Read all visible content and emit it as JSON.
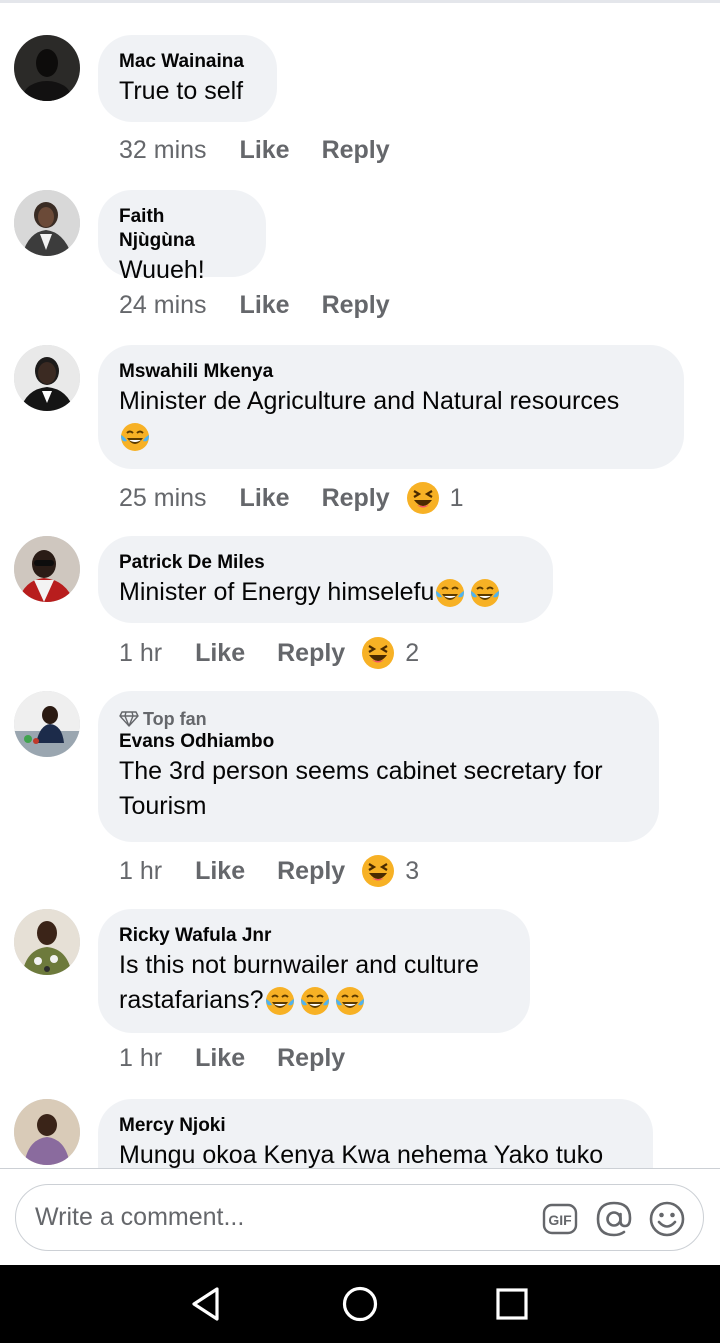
{
  "comments": [
    {
      "author": "Mac Wainaina",
      "text": "True to self",
      "time": "32 mins",
      "like": "Like",
      "reply": "Reply",
      "reaction_count": ""
    },
    {
      "author": "Faith Njùgùna",
      "text": "Wuueh!",
      "time": "24 mins",
      "like": "Like",
      "reply": "Reply",
      "reaction_count": ""
    },
    {
      "author": "Mswahili Mkenya",
      "text": "Minister de Agriculture and Natural resources",
      "time": "25 mins",
      "like": "Like",
      "reply": "Reply",
      "reaction_count": "1"
    },
    {
      "author": "Patrick De Miles",
      "text": "Minister of Energy himselefu",
      "time": "1 hr",
      "like": "Like",
      "reply": "Reply",
      "reaction_count": "2"
    },
    {
      "badge": "Top fan",
      "author": "Evans Odhiambo",
      "text_line1": "The 3rd person seems cabinet secretary for",
      "text_line2": "Tourism",
      "time": "1 hr",
      "like": "Like",
      "reply": "Reply",
      "reaction_count": "3"
    },
    {
      "author": "Ricky Wafula Jnr",
      "text_line1": "Is this not burnwailer and culture",
      "text_line2": "rastafarians?",
      "time": "1 hr",
      "like": "Like",
      "reply": "Reply",
      "reaction_count": ""
    },
    {
      "author": "Mercy Njoki",
      "text": "Mungu okoa Kenya Kwa nehema Yako tuko"
    }
  ],
  "composer": {
    "placeholder": "Write a comment...",
    "gif_label": "GIF"
  },
  "icons": {
    "reaction": "laughing-face-icon",
    "inline_emoji": "tears-of-joy-emoji",
    "mention": "at-sign-icon",
    "emoji_picker": "smiley-icon",
    "nav": [
      "back-triangle-icon",
      "home-circle-icon",
      "recents-square-icon"
    ]
  },
  "colors": {
    "bubble": "#f0f2f5",
    "meta_text": "#65676b",
    "emoji_yellow": "#f7b125",
    "navbar": "#000000"
  }
}
